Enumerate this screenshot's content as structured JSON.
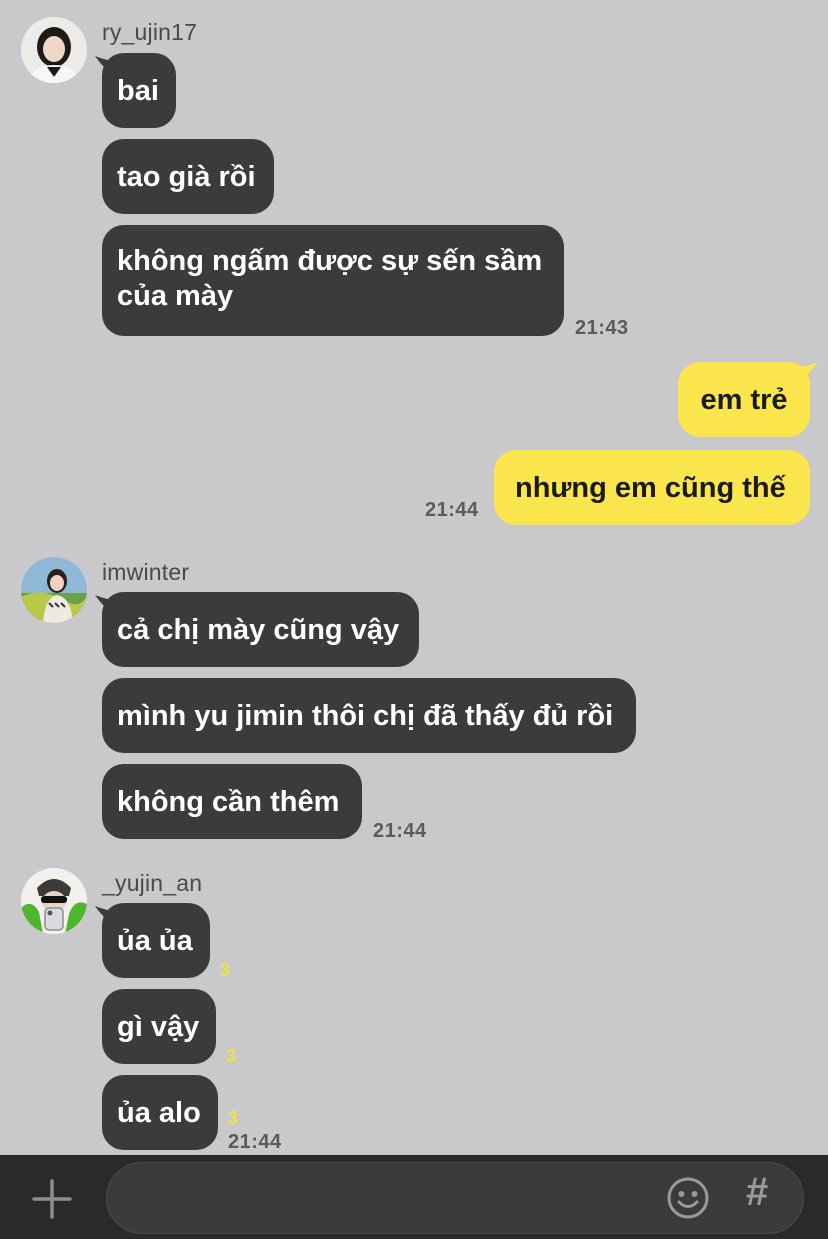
{
  "groups": [
    {
      "sender": "ry_ujin17",
      "messages": [
        "bai",
        "tao già rồi",
        "không ngấm được sự sến sầm của mày"
      ],
      "time": "21:43"
    },
    {
      "sender": "imwinter",
      "messages": [
        "cả chị mày cũng vậy",
        "mình yu jimin thôi chị đã thấy đủ rồi",
        "không cần thêm"
      ],
      "time": "21:44"
    },
    {
      "sender": "_yujin_an",
      "messages": [
        "ủa ủa",
        "gì vậy",
        "ủa alo"
      ],
      "unread": [
        "3",
        "3",
        "3"
      ],
      "time": "21:44"
    }
  ],
  "mine": {
    "messages": [
      "em trẻ",
      "nhưng em cũng thế"
    ],
    "time": "21:44"
  },
  "composer": {
    "placeholder": "",
    "hash_label": "#"
  },
  "colors": {
    "background": "#c9c9cb",
    "incoming_bubble": "#3b3b3d",
    "outgoing_bubble": "#fbe54d",
    "unread_count": "#f2e33c"
  },
  "icons": [
    "add-icon",
    "emoji-icon",
    "hashtag-icon"
  ]
}
